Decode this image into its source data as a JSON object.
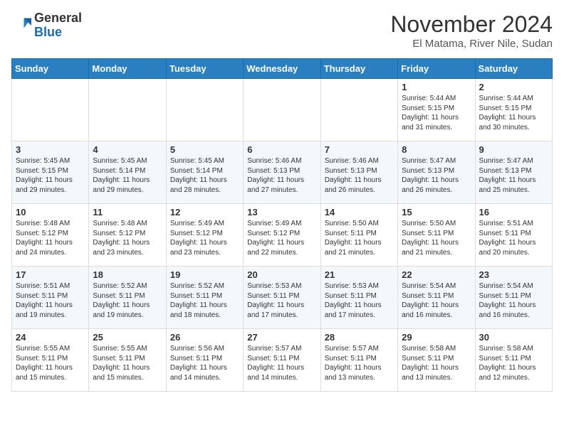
{
  "header": {
    "logo_line1": "General",
    "logo_line2": "Blue",
    "month_title": "November 2024",
    "location": "El Matama, River Nile, Sudan"
  },
  "weekdays": [
    "Sunday",
    "Monday",
    "Tuesday",
    "Wednesday",
    "Thursday",
    "Friday",
    "Saturday"
  ],
  "weeks": [
    [
      {
        "day": "",
        "info": ""
      },
      {
        "day": "",
        "info": ""
      },
      {
        "day": "",
        "info": ""
      },
      {
        "day": "",
        "info": ""
      },
      {
        "day": "",
        "info": ""
      },
      {
        "day": "1",
        "info": "Sunrise: 5:44 AM\nSunset: 5:15 PM\nDaylight: 11 hours\nand 31 minutes."
      },
      {
        "day": "2",
        "info": "Sunrise: 5:44 AM\nSunset: 5:15 PM\nDaylight: 11 hours\nand 30 minutes."
      }
    ],
    [
      {
        "day": "3",
        "info": "Sunrise: 5:45 AM\nSunset: 5:15 PM\nDaylight: 11 hours\nand 29 minutes."
      },
      {
        "day": "4",
        "info": "Sunrise: 5:45 AM\nSunset: 5:14 PM\nDaylight: 11 hours\nand 29 minutes."
      },
      {
        "day": "5",
        "info": "Sunrise: 5:45 AM\nSunset: 5:14 PM\nDaylight: 11 hours\nand 28 minutes."
      },
      {
        "day": "6",
        "info": "Sunrise: 5:46 AM\nSunset: 5:13 PM\nDaylight: 11 hours\nand 27 minutes."
      },
      {
        "day": "7",
        "info": "Sunrise: 5:46 AM\nSunset: 5:13 PM\nDaylight: 11 hours\nand 26 minutes."
      },
      {
        "day": "8",
        "info": "Sunrise: 5:47 AM\nSunset: 5:13 PM\nDaylight: 11 hours\nand 26 minutes."
      },
      {
        "day": "9",
        "info": "Sunrise: 5:47 AM\nSunset: 5:13 PM\nDaylight: 11 hours\nand 25 minutes."
      }
    ],
    [
      {
        "day": "10",
        "info": "Sunrise: 5:48 AM\nSunset: 5:12 PM\nDaylight: 11 hours\nand 24 minutes."
      },
      {
        "day": "11",
        "info": "Sunrise: 5:48 AM\nSunset: 5:12 PM\nDaylight: 11 hours\nand 23 minutes."
      },
      {
        "day": "12",
        "info": "Sunrise: 5:49 AM\nSunset: 5:12 PM\nDaylight: 11 hours\nand 23 minutes."
      },
      {
        "day": "13",
        "info": "Sunrise: 5:49 AM\nSunset: 5:12 PM\nDaylight: 11 hours\nand 22 minutes."
      },
      {
        "day": "14",
        "info": "Sunrise: 5:50 AM\nSunset: 5:11 PM\nDaylight: 11 hours\nand 21 minutes."
      },
      {
        "day": "15",
        "info": "Sunrise: 5:50 AM\nSunset: 5:11 PM\nDaylight: 11 hours\nand 21 minutes."
      },
      {
        "day": "16",
        "info": "Sunrise: 5:51 AM\nSunset: 5:11 PM\nDaylight: 11 hours\nand 20 minutes."
      }
    ],
    [
      {
        "day": "17",
        "info": "Sunrise: 5:51 AM\nSunset: 5:11 PM\nDaylight: 11 hours\nand 19 minutes."
      },
      {
        "day": "18",
        "info": "Sunrise: 5:52 AM\nSunset: 5:11 PM\nDaylight: 11 hours\nand 19 minutes."
      },
      {
        "day": "19",
        "info": "Sunrise: 5:52 AM\nSunset: 5:11 PM\nDaylight: 11 hours\nand 18 minutes."
      },
      {
        "day": "20",
        "info": "Sunrise: 5:53 AM\nSunset: 5:11 PM\nDaylight: 11 hours\nand 17 minutes."
      },
      {
        "day": "21",
        "info": "Sunrise: 5:53 AM\nSunset: 5:11 PM\nDaylight: 11 hours\nand 17 minutes."
      },
      {
        "day": "22",
        "info": "Sunrise: 5:54 AM\nSunset: 5:11 PM\nDaylight: 11 hours\nand 16 minutes."
      },
      {
        "day": "23",
        "info": "Sunrise: 5:54 AM\nSunset: 5:11 PM\nDaylight: 11 hours\nand 16 minutes."
      }
    ],
    [
      {
        "day": "24",
        "info": "Sunrise: 5:55 AM\nSunset: 5:11 PM\nDaylight: 11 hours\nand 15 minutes."
      },
      {
        "day": "25",
        "info": "Sunrise: 5:55 AM\nSunset: 5:11 PM\nDaylight: 11 hours\nand 15 minutes."
      },
      {
        "day": "26",
        "info": "Sunrise: 5:56 AM\nSunset: 5:11 PM\nDaylight: 11 hours\nand 14 minutes."
      },
      {
        "day": "27",
        "info": "Sunrise: 5:57 AM\nSunset: 5:11 PM\nDaylight: 11 hours\nand 14 minutes."
      },
      {
        "day": "28",
        "info": "Sunrise: 5:57 AM\nSunset: 5:11 PM\nDaylight: 11 hours\nand 13 minutes."
      },
      {
        "day": "29",
        "info": "Sunrise: 5:58 AM\nSunset: 5:11 PM\nDaylight: 11 hours\nand 13 minutes."
      },
      {
        "day": "30",
        "info": "Sunrise: 5:58 AM\nSunset: 5:11 PM\nDaylight: 11 hours\nand 12 minutes."
      }
    ]
  ]
}
